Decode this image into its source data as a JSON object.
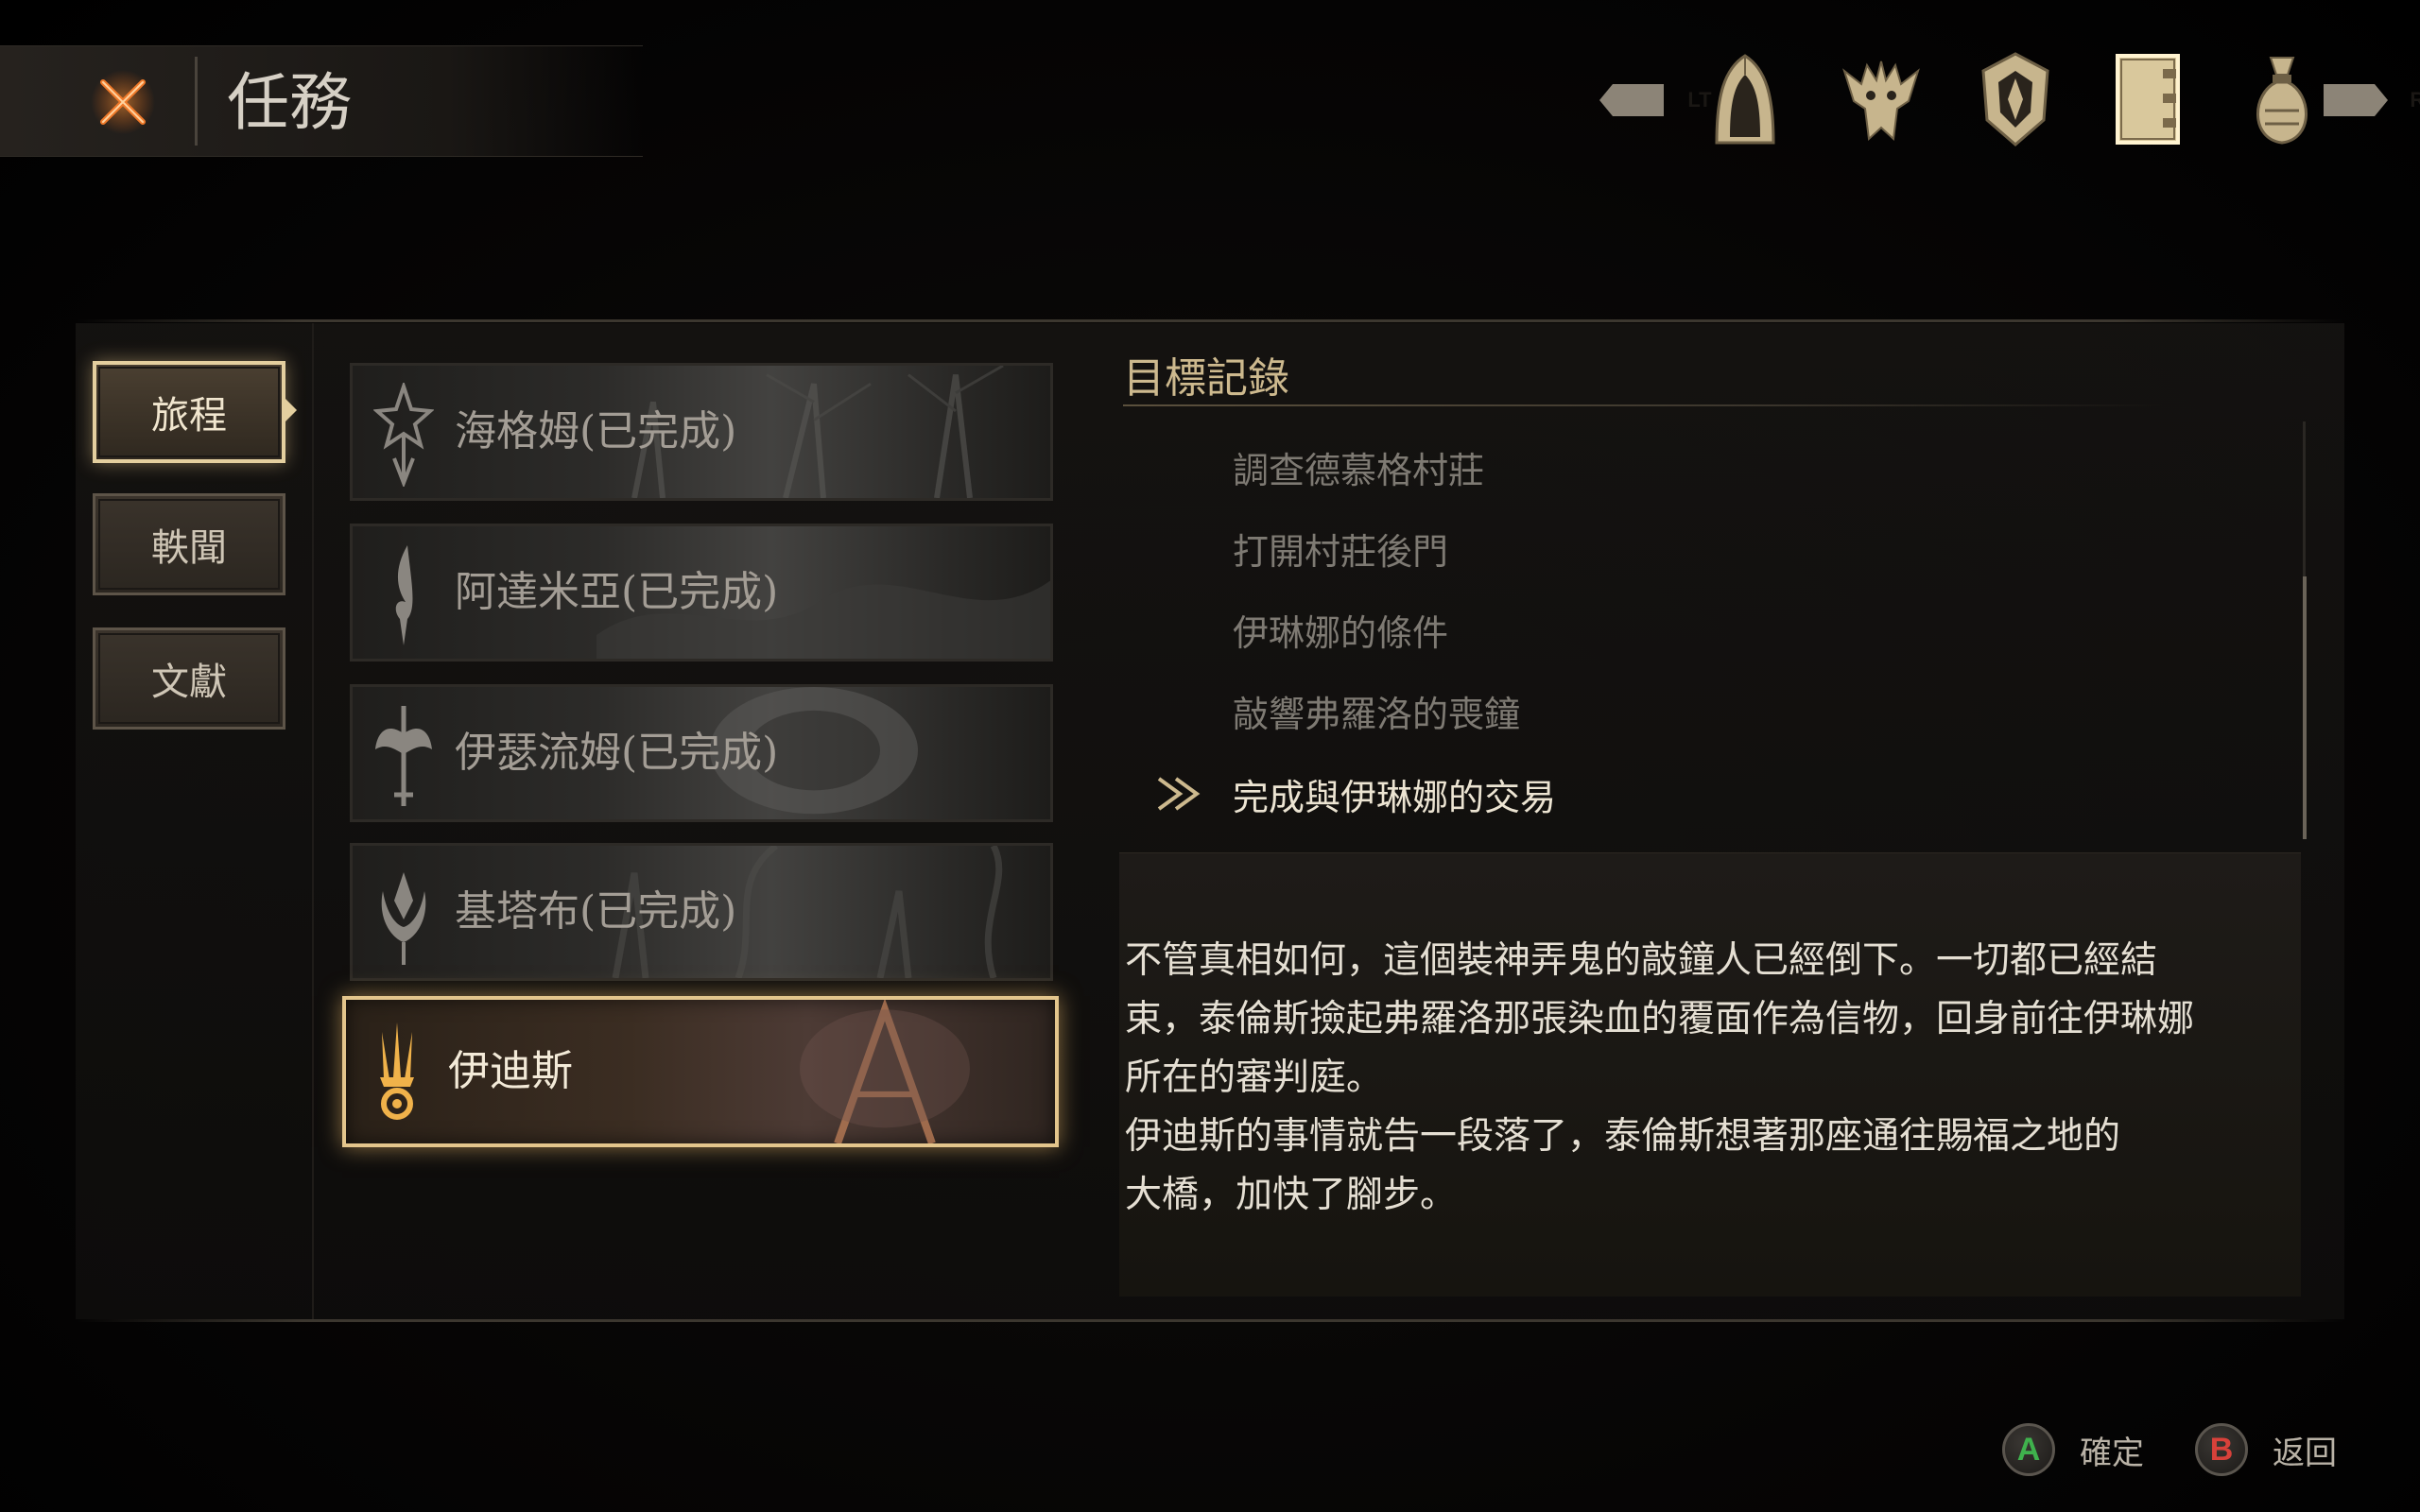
{
  "header": {
    "title": "任務",
    "close_icon": "close-x-icon"
  },
  "top_nav": {
    "left_trigger": "LT",
    "right_trigger": "RT",
    "items": [
      {
        "name": "hood-icon"
      },
      {
        "name": "beast-skull-icon"
      },
      {
        "name": "crest-shield-icon"
      },
      {
        "name": "journal-book-icon"
      },
      {
        "name": "coin-pouch-icon"
      }
    ],
    "active_index": 3
  },
  "categories": [
    {
      "label": "旅程",
      "active": true
    },
    {
      "label": "軼聞",
      "active": false
    },
    {
      "label": "文獻",
      "active": false
    }
  ],
  "quests": [
    {
      "label": "海格姆(已完成)",
      "icon": "star-spire-icon",
      "completed": true
    },
    {
      "label": "阿達米亞(已完成)",
      "icon": "flame-blade-icon",
      "completed": true
    },
    {
      "label": "伊瑟流姆(已完成)",
      "icon": "winged-sword-icon",
      "completed": true
    },
    {
      "label": "基塔布(已完成)",
      "icon": "horned-emblem-icon",
      "completed": true
    },
    {
      "label": "伊迪斯",
      "icon": "trident-flame-icon",
      "completed": false,
      "active": true
    }
  ],
  "objectives": {
    "header": "目標記錄",
    "items": [
      {
        "text": "調查德慕格村莊",
        "current": false
      },
      {
        "text": "打開村莊後門",
        "current": false
      },
      {
        "text": "伊琳娜的條件",
        "current": false
      },
      {
        "text": "敲響弗羅洛的喪鐘",
        "current": false
      },
      {
        "text": "完成與伊琳娜的交易",
        "current": true
      }
    ]
  },
  "description": {
    "lines": [
      "不管真相如何，這個裝神弄鬼的敲鐘人已經倒下。一切都已經結",
      "束，泰倫斯撿起弗羅洛那張染血的覆面作為信物，回身前往伊琳娜",
      "所在的審判庭。",
      "伊迪斯的事情就告一段落了，泰倫斯想著那座通往賜福之地的",
      "大橋，加快了腳步。"
    ]
  },
  "footer": {
    "confirm": {
      "button": "A",
      "label": "確定",
      "color": "#3fb14d"
    },
    "back": {
      "button": "B",
      "label": "返回",
      "color": "#d8413a"
    }
  },
  "colors": {
    "accent_gold": "#e3c58c",
    "close_orange": "#e8601c",
    "objective_header": "#cdb98e"
  }
}
